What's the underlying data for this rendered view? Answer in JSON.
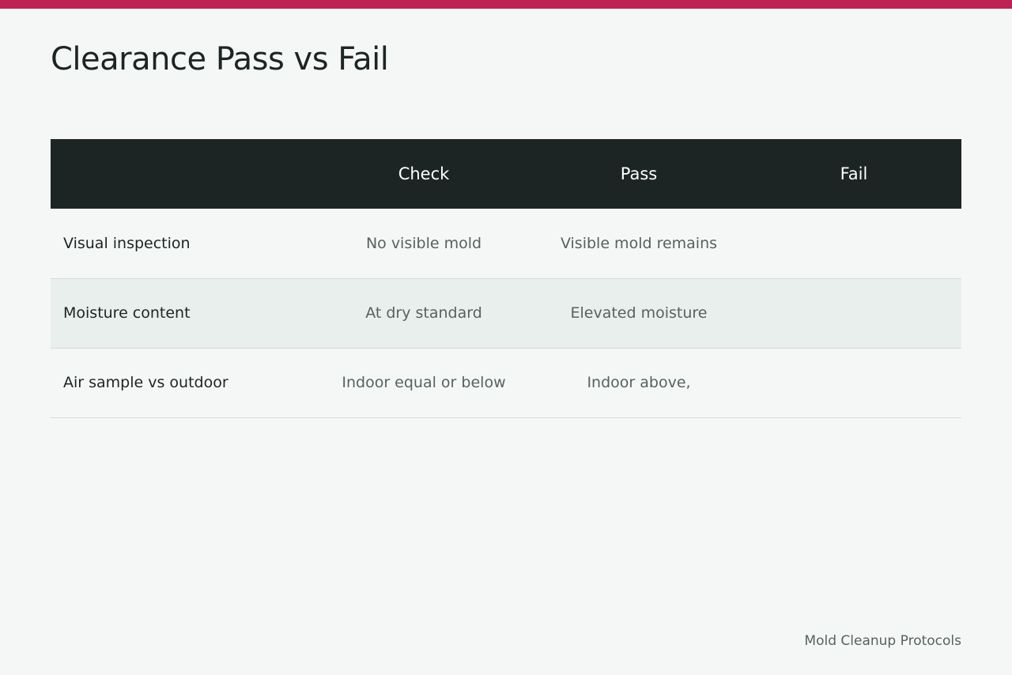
{
  "accent_color": "#be2152",
  "header_color": "#1d2424",
  "title": "Clearance Pass vs Fail",
  "table": {
    "columns": [
      "",
      "Check",
      "Pass",
      "Fail"
    ],
    "rows": [
      {
        "label": "Visual inspection",
        "check": "No visible mold",
        "pass": "Visible mold remains",
        "fail": ""
      },
      {
        "label": "Moisture content",
        "check": "At dry standard",
        "pass": "Elevated moisture",
        "fail": ""
      },
      {
        "label": "Air sample vs outdoor",
        "check": "Indoor equal or below",
        "pass": "Indoor above,",
        "fail": ""
      }
    ]
  },
  "footer": "Mold Cleanup Protocols"
}
